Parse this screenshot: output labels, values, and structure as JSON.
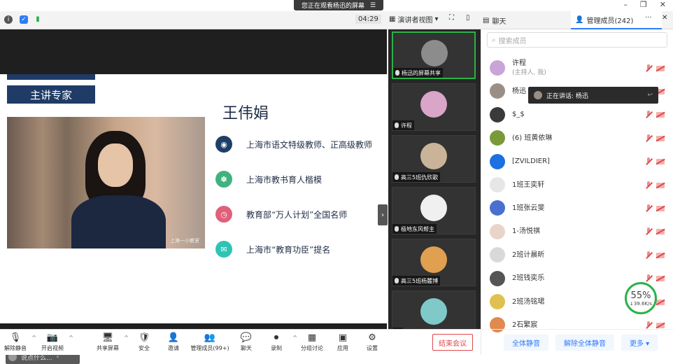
{
  "banner": {
    "text": "您正在观看杨迅的屏幕",
    "menu_icon": "menu-icon"
  },
  "window": {
    "minimize": "–",
    "restore": "❐",
    "close": "✕"
  },
  "topbar": {
    "timer": "04:29",
    "view_mode": "演讲者视图",
    "chat_tab": "聊天",
    "members_tab": "管理成员(242)",
    "more": "···",
    "close": "✕"
  },
  "slide": {
    "section_title": "主讲专家",
    "speaker_name": "王伟娟",
    "photo_watermark": "上海一小教室",
    "items": [
      {
        "text": "上海市语文特级教师、正高级教师",
        "color": "#1e3f66",
        "icon": "eye-icon"
      },
      {
        "text": "上海市教书育人楷模",
        "color": "#3fb37f",
        "icon": "globe-icon"
      },
      {
        "text": "教育部“万人计划”全国名师",
        "color": "#e0607a",
        "icon": "clock-icon"
      },
      {
        "text": "上海市“教育功臣”提名",
        "color": "#2fc3b5",
        "icon": "shield-icon"
      }
    ]
  },
  "chat_input": {
    "placeholder": "说点什么...",
    "toggle": "‹"
  },
  "gallery": [
    {
      "caption": "杨迅的屏幕共享",
      "avatar_color": "#8c8c8c",
      "active": true
    },
    {
      "caption": "许程",
      "avatar_color": "#d9a5c9",
      "active": false
    },
    {
      "caption": "高三5班仇欣歌",
      "avatar_color": "#c9b49a",
      "active": false
    },
    {
      "caption": "极地东风帮主",
      "avatar_color": "#f0f0f0",
      "active": false
    },
    {
      "caption": "高三5班杨麓博",
      "avatar_color": "#e0a050",
      "active": false
    },
    {
      "caption": "",
      "avatar_color": "#7fc9c9",
      "active": false
    }
  ],
  "members": {
    "search_placeholder": "搜索成员",
    "speaking_banner": "正在讲话: 杨迅",
    "list": [
      {
        "name": "许程",
        "sub": "(主持人, 我)",
        "color": "#c9a4d6"
      },
      {
        "name": "杨迅",
        "sub": "",
        "color": "#9a8f86"
      },
      {
        "name": "$_$",
        "sub": "",
        "color": "#3a3a3a"
      },
      {
        "name": "(6) 班黄依琳",
        "sub": "",
        "color": "#7a9a3a"
      },
      {
        "name": "[ZVILDIER]",
        "sub": "",
        "color": "#1e6fe0"
      },
      {
        "name": "1班王奕轩",
        "sub": "",
        "color": "#e6e6e6"
      },
      {
        "name": "1班张云斐",
        "sub": "",
        "color": "#4a6fcf"
      },
      {
        "name": "1-汤悦祺",
        "sub": "",
        "color": "#e9d4c9"
      },
      {
        "name": "2班计晨昕",
        "sub": "",
        "color": "#d9d9d9"
      },
      {
        "name": "2班钱奕乐",
        "sub": "",
        "color": "#555555"
      },
      {
        "name": "2班汤铭珺",
        "sub": "",
        "color": "#e0c050"
      },
      {
        "name": "2石繁宸",
        "sub": "",
        "color": "#e08a50"
      }
    ],
    "footer": {
      "mute_all": "全体静音",
      "unmute_all": "解除全体静音",
      "more": "更多 ▾"
    }
  },
  "network": {
    "percent": "55%",
    "speed": "↓39.6K/s"
  },
  "toolbar": [
    {
      "label": "解除静音",
      "glyph": "🎙",
      "caret": true,
      "icon": "microphone-muted-icon"
    },
    {
      "label": "开启视频",
      "glyph": "📷",
      "caret": true,
      "icon": "camera-off-icon"
    },
    {
      "label": "共享屏幕",
      "glyph": "🖥",
      "caret": true,
      "icon": "share-screen-icon"
    },
    {
      "label": "安全",
      "glyph": "🛡",
      "caret": false,
      "icon": "security-icon"
    },
    {
      "label": "邀请",
      "glyph": "👤",
      "caret": false,
      "icon": "invite-icon"
    },
    {
      "label": "管理成员(99+)",
      "glyph": "👥",
      "caret": false,
      "icon": "members-icon"
    },
    {
      "label": "聊天",
      "glyph": "💬",
      "caret": false,
      "icon": "chat-icon"
    },
    {
      "label": "录制",
      "glyph": "⏺",
      "caret": true,
      "icon": "record-icon"
    },
    {
      "label": "分组讨论",
      "glyph": "▦",
      "caret": false,
      "icon": "breakout-icon"
    },
    {
      "label": "应用",
      "glyph": "▣",
      "caret": false,
      "icon": "apps-icon"
    },
    {
      "label": "设置",
      "glyph": "⚙",
      "caret": false,
      "icon": "settings-icon"
    }
  ],
  "end_meeting": "结束会议"
}
